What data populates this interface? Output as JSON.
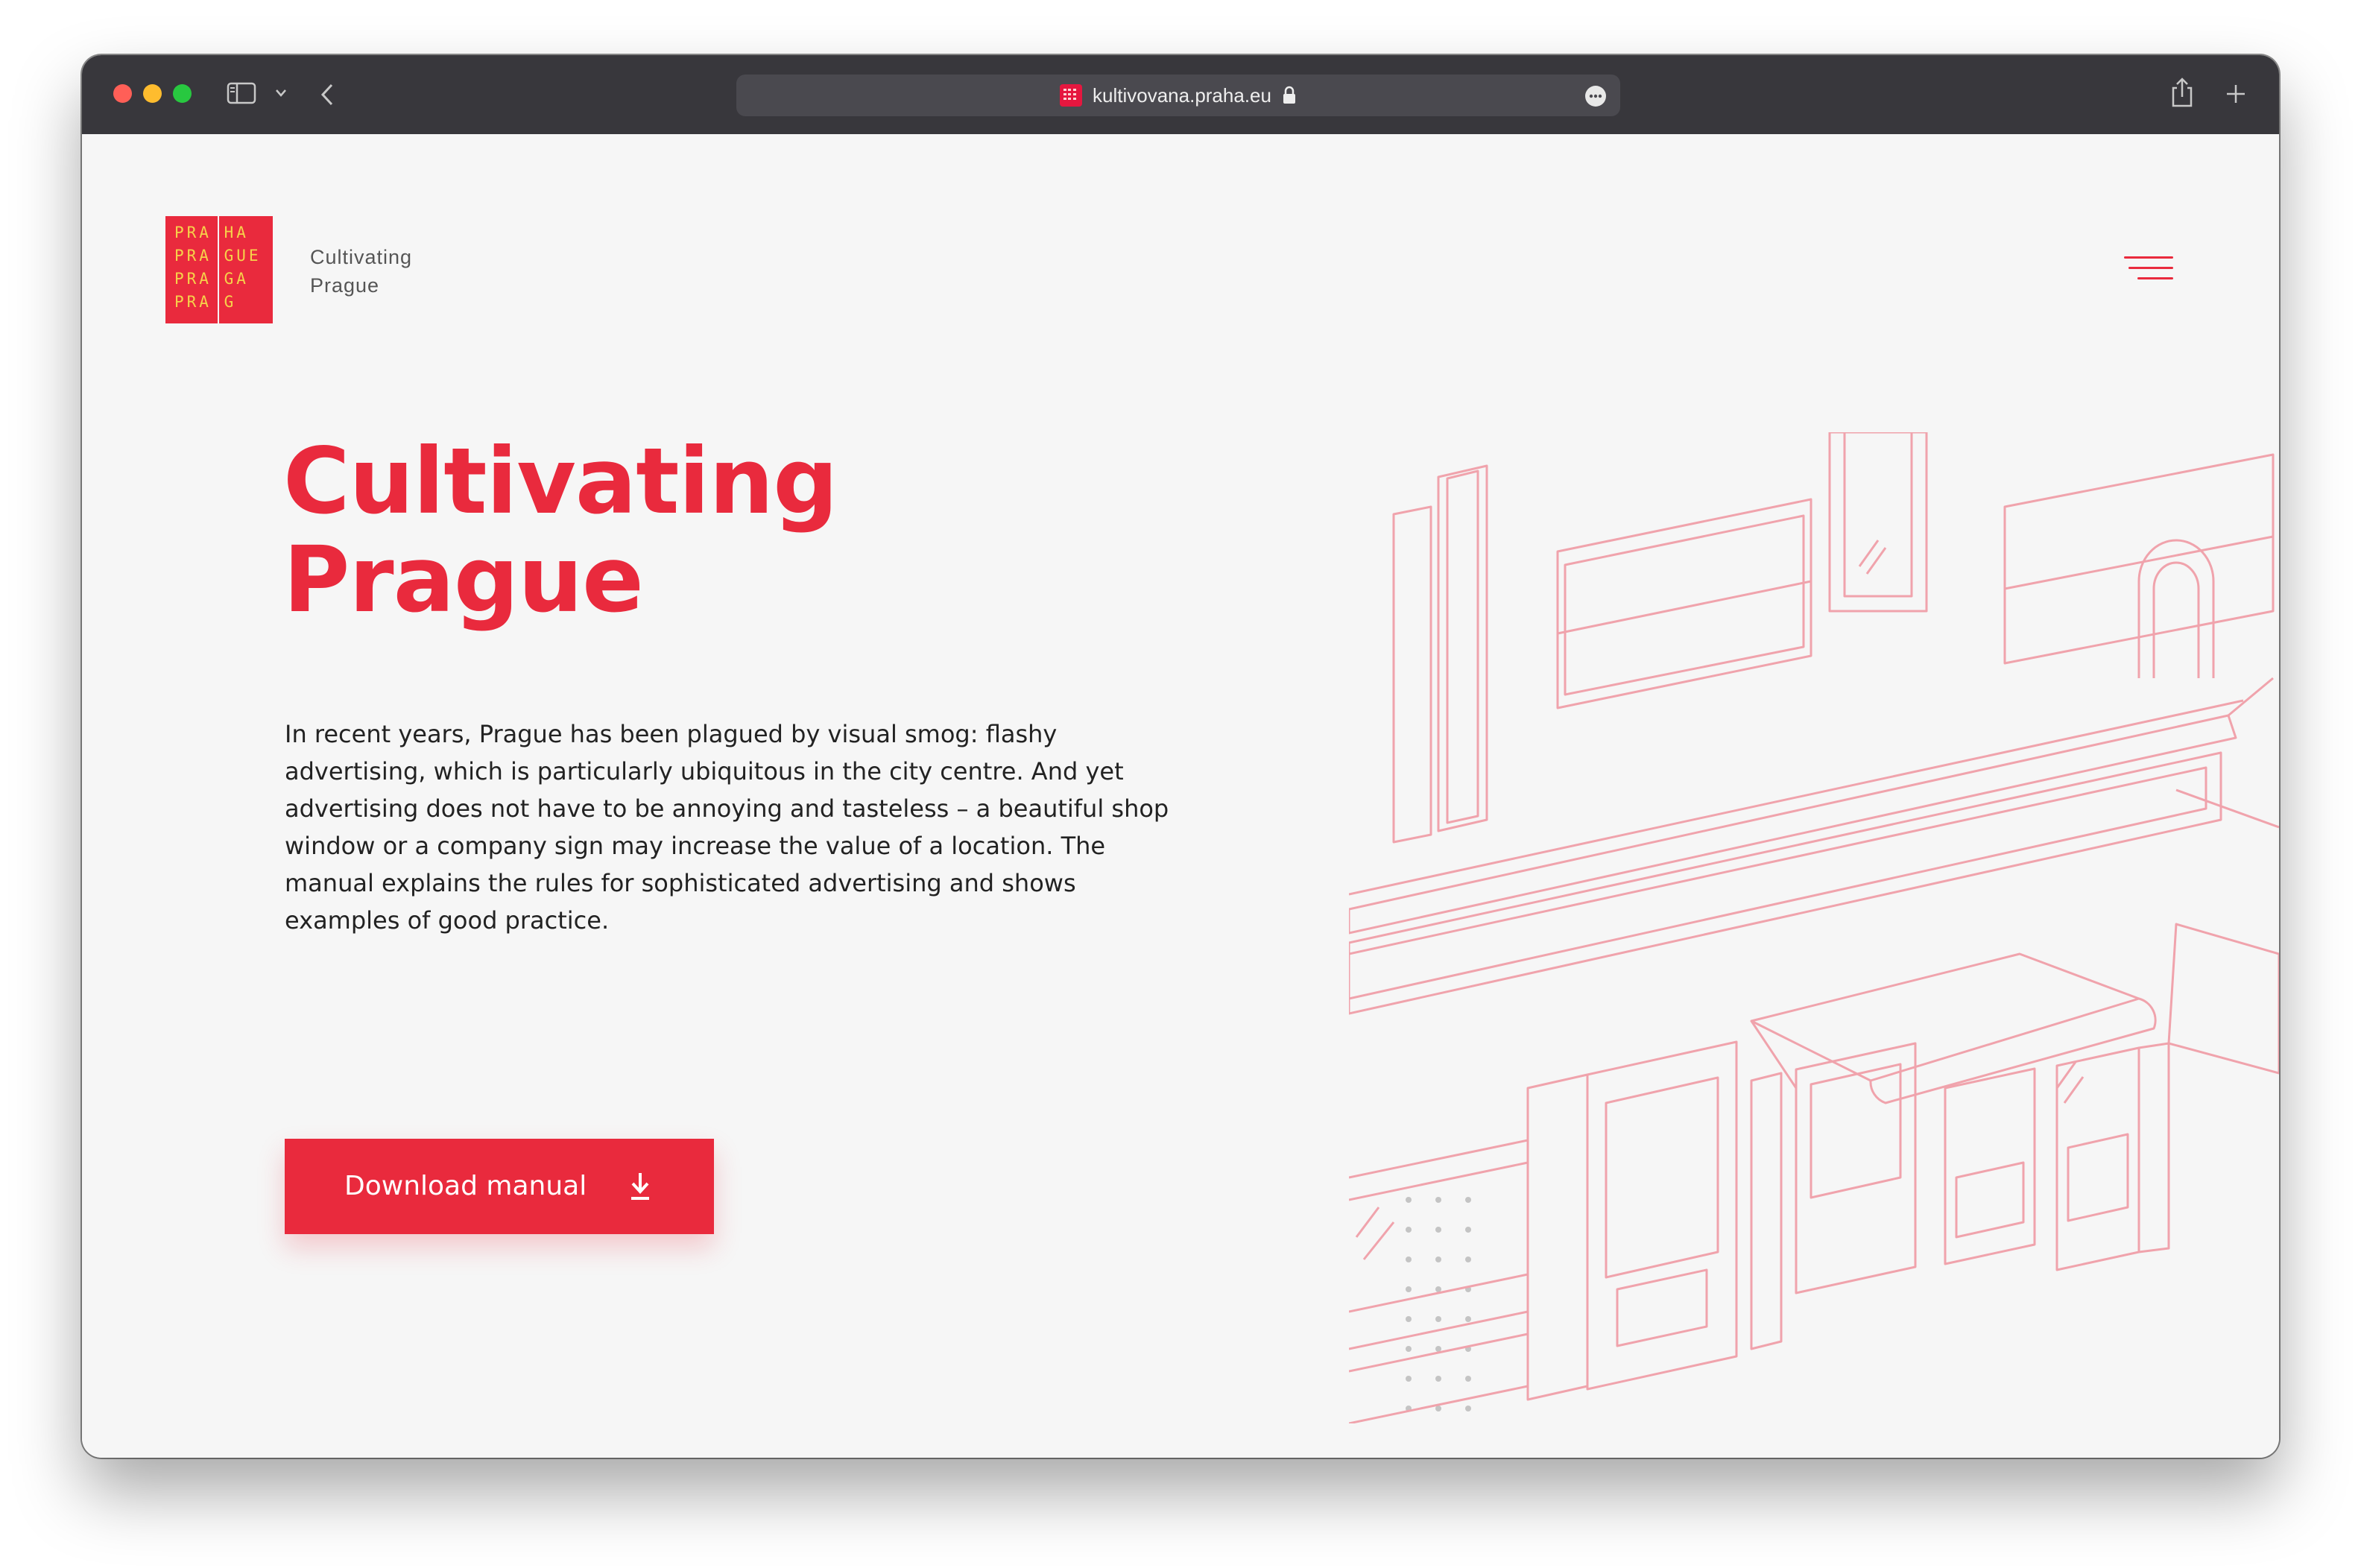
{
  "browser": {
    "url": "kultivovana.praha.eu",
    "icons": [
      "sidebar-icon",
      "chevron-down-icon",
      "back-icon",
      "lock-icon",
      "more-icon",
      "share-icon",
      "new-tab-icon"
    ]
  },
  "site": {
    "logo_lines": [
      "PRA HA",
      "PRA GUE",
      "PRA GA",
      "PRA G"
    ],
    "brand_line1": "Cultivating",
    "brand_line2": "Prague",
    "menu_icon": "hamburger-menu-icon"
  },
  "hero": {
    "title_line1": "Cultivating",
    "title_line2": "Prague",
    "description": "In recent years, Prague has been plagued by visual smog: flashy advertising, which is particularly ubiquitous in the city centre. And yet advertising does not have to be annoying and tasteless – a beautiful shop window or a company sign may increase the value of a location. The manual explains the rules for sophisticated advertising and shows examples of good practice.",
    "button_label": "Download manual",
    "button_icon": "download-icon"
  },
  "colors": {
    "accent": "#e92a3d",
    "logo_text": "#f6d24a",
    "titlebar": "#38373c",
    "background": "#f6f6f6",
    "illustration_line": "#f0a3ac"
  }
}
